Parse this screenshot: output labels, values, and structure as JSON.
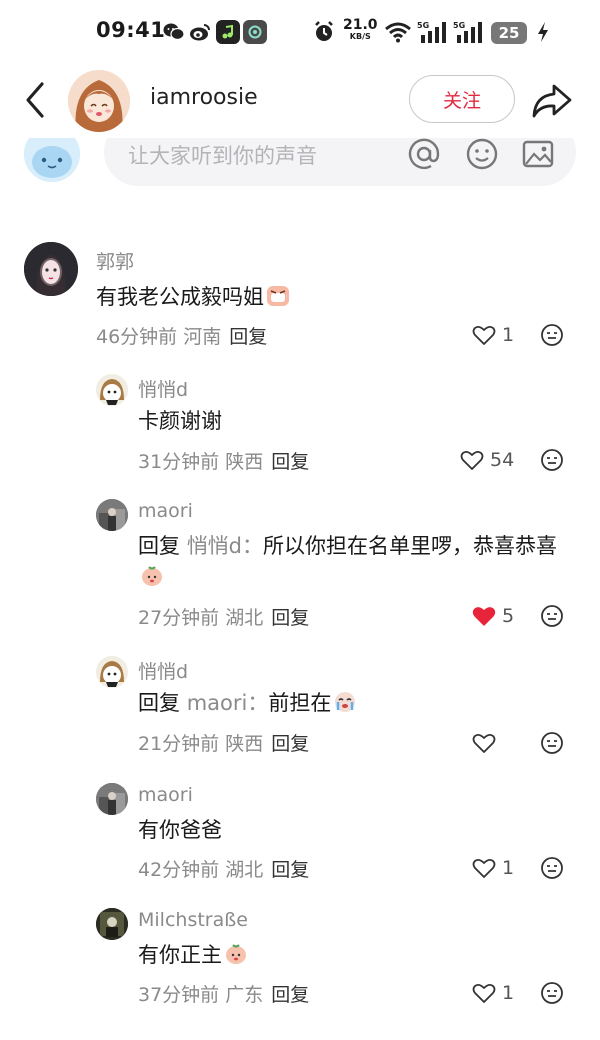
{
  "status_bar": {
    "time": "09:41",
    "net_speed": "21.0",
    "net_unit": "KB/S",
    "signal_1": "5G",
    "signal_2": "5G",
    "battery": "25"
  },
  "header": {
    "username": "iamroosie",
    "follow_label": "关注"
  },
  "input": {
    "placeholder": "让大家听到你的声音"
  },
  "comments": [
    {
      "name": "郭郭",
      "text": "有我老公成毅吗姐",
      "time": "46分钟前",
      "location": "河南",
      "reply_label": "回复",
      "likes": "1",
      "liked": false
    },
    {
      "name": "悄悄d",
      "text": "卡颜谢谢",
      "time": "31分钟前",
      "location": "陕西",
      "reply_label": "回复",
      "likes": "54",
      "liked": false
    },
    {
      "name": "maori",
      "reply_prefix": "回复",
      "reply_to": "悄悄d：",
      "text": "所以你担在名单里啰，恭喜恭喜",
      "time": "27分钟前",
      "location": "湖北",
      "reply_label": "回复",
      "likes": "5",
      "liked": true
    },
    {
      "name": "悄悄d",
      "reply_prefix": "回复",
      "reply_to": "maori：",
      "text": "前担在",
      "time": "21分钟前",
      "location": "陕西",
      "reply_label": "回复",
      "likes": "",
      "liked": false
    },
    {
      "name": "maori",
      "text": "有你爸爸",
      "time": "42分钟前",
      "location": "湖北",
      "reply_label": "回复",
      "likes": "1",
      "liked": false
    },
    {
      "name": "Milchstraße",
      "text": "有你正主",
      "time": "37分钟前",
      "location": "广东",
      "reply_label": "回复",
      "likes": "1",
      "liked": false
    }
  ],
  "colors": {
    "accent_red": "#e3293f",
    "liked_heart": "#e8243a",
    "secondary_text": "#8a8a8a"
  }
}
